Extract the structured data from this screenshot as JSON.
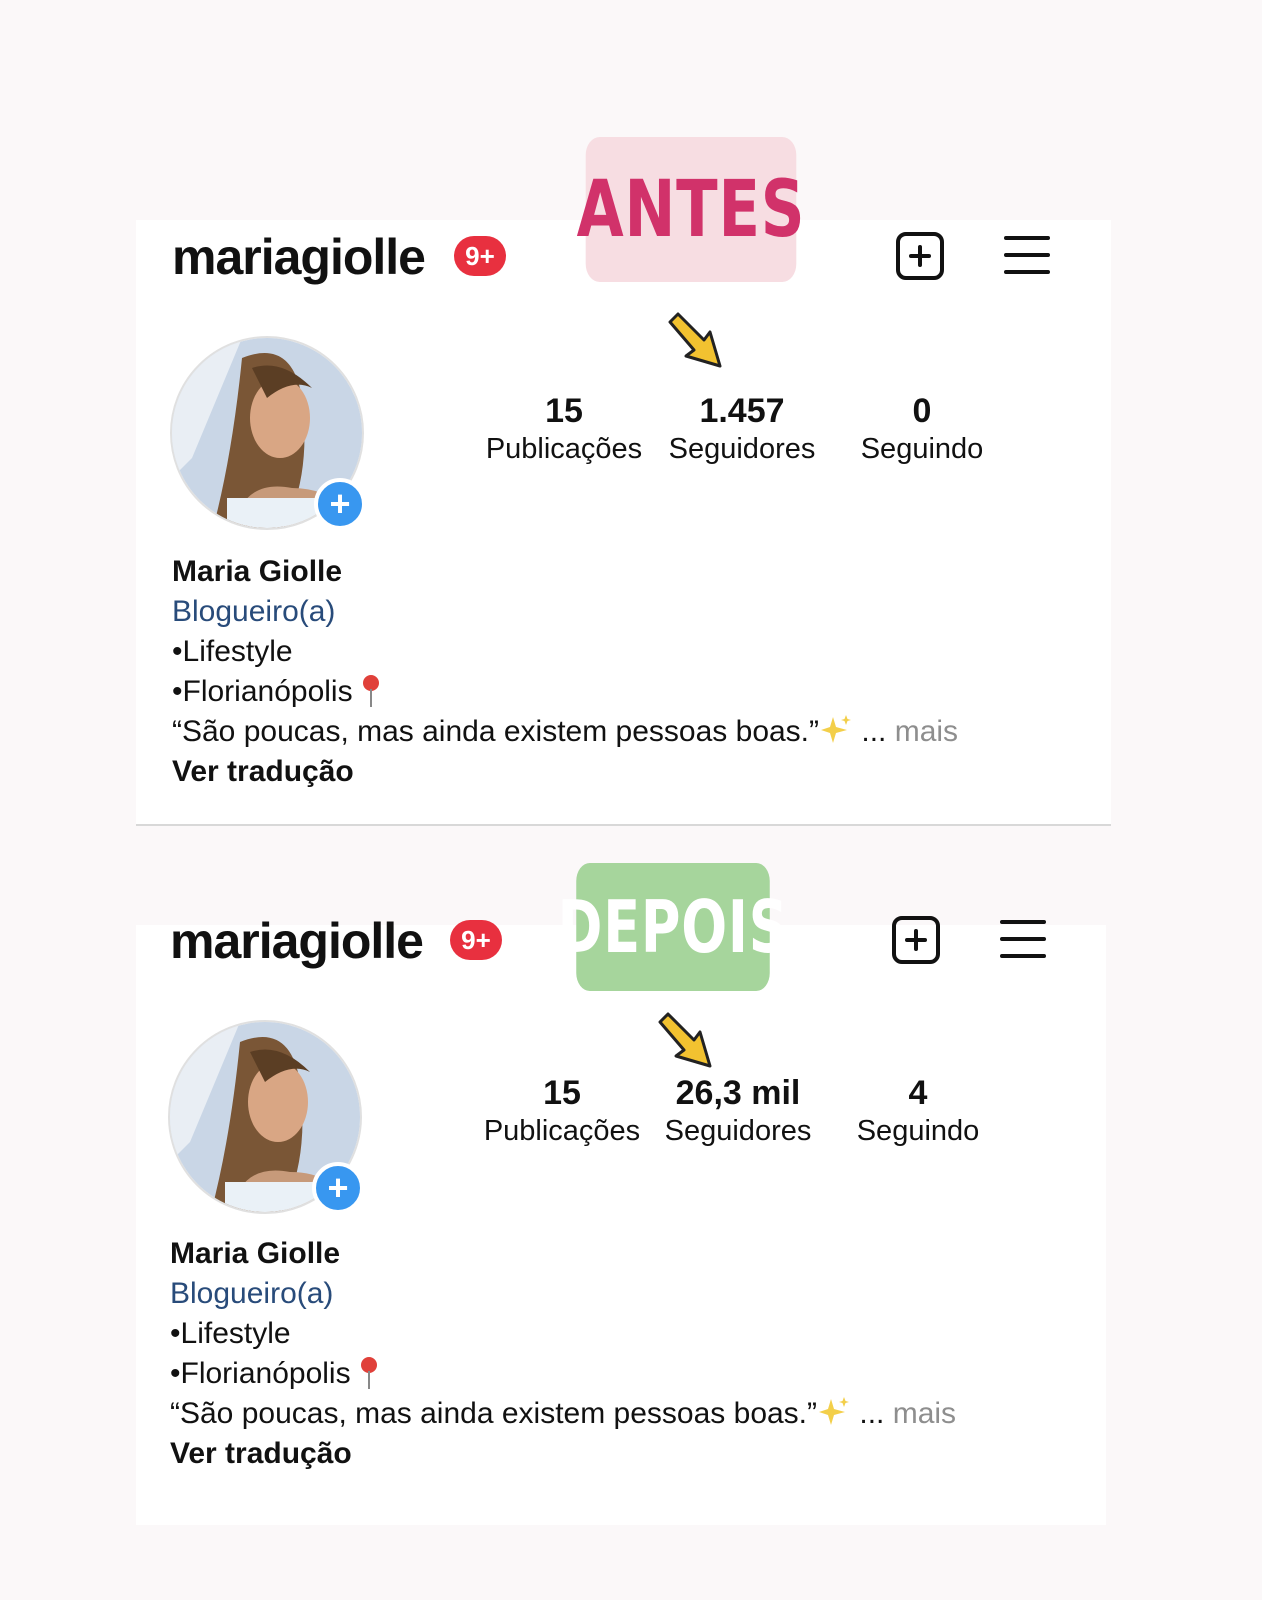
{
  "labels": {
    "before": "ANTES",
    "after": "DEPOIS"
  },
  "colors": {
    "before_label_bg": "#f7dde2",
    "before_label_text": "#d1326a",
    "after_label_bg": "#a6d59c",
    "after_label_text": "#ffffff",
    "badge": "#e8303f",
    "add_story": "#3897f0",
    "category": "#284b7a",
    "arrow": "#f2c230"
  },
  "profiles": [
    {
      "username": "mariagiolle",
      "notifications_badge": "9+",
      "icons": [
        "new-post-icon",
        "menu-icon"
      ],
      "stats": [
        {
          "value": "15",
          "label": "Publicações"
        },
        {
          "value": "1.457",
          "label": "Seguidores"
        },
        {
          "value": "0",
          "label": "Seguindo"
        }
      ],
      "bio": {
        "name": "Maria Giolle",
        "category": "Blogueiro(a)",
        "line1": "•Lifestyle",
        "line2": "•Florianópolis",
        "quote": "“São poucas, mas ainda existem pessoas boas.”",
        "ellipsis": "...",
        "more": "mais",
        "translate": "Ver tradução"
      }
    },
    {
      "username": "mariagiolle",
      "notifications_badge": "9+",
      "icons": [
        "new-post-icon",
        "menu-icon"
      ],
      "stats": [
        {
          "value": "15",
          "label": "Publicações"
        },
        {
          "value": "26,3 mil",
          "label": "Seguidores"
        },
        {
          "value": "4",
          "label": "Seguindo"
        }
      ],
      "bio": {
        "name": "Maria Giolle",
        "category": "Blogueiro(a)",
        "line1": "•Lifestyle",
        "line2": "•Florianópolis",
        "quote": "“São poucas, mas ainda existem pessoas boas.”",
        "ellipsis": "...",
        "more": "mais",
        "translate": "Ver tradução"
      }
    }
  ]
}
